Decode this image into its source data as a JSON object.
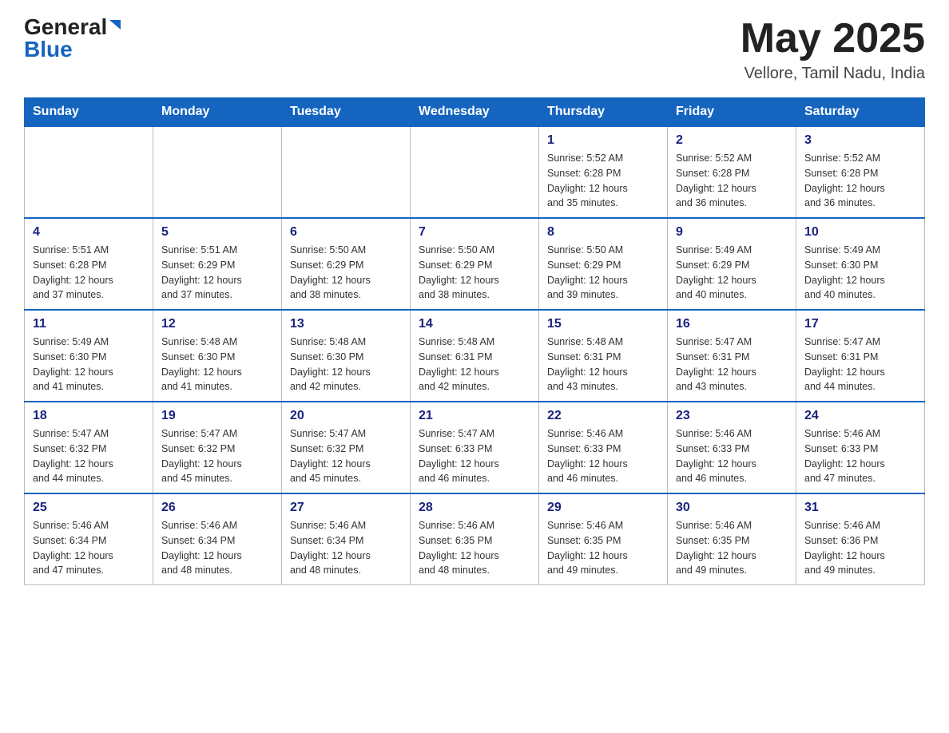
{
  "header": {
    "logo_general": "General",
    "logo_blue": "Blue",
    "month": "May 2025",
    "location": "Vellore, Tamil Nadu, India"
  },
  "days_of_week": [
    "Sunday",
    "Monday",
    "Tuesday",
    "Wednesday",
    "Thursday",
    "Friday",
    "Saturday"
  ],
  "weeks": [
    [
      {
        "day": "",
        "info": ""
      },
      {
        "day": "",
        "info": ""
      },
      {
        "day": "",
        "info": ""
      },
      {
        "day": "",
        "info": ""
      },
      {
        "day": "1",
        "info": "Sunrise: 5:52 AM\nSunset: 6:28 PM\nDaylight: 12 hours\nand 35 minutes."
      },
      {
        "day": "2",
        "info": "Sunrise: 5:52 AM\nSunset: 6:28 PM\nDaylight: 12 hours\nand 36 minutes."
      },
      {
        "day": "3",
        "info": "Sunrise: 5:52 AM\nSunset: 6:28 PM\nDaylight: 12 hours\nand 36 minutes."
      }
    ],
    [
      {
        "day": "4",
        "info": "Sunrise: 5:51 AM\nSunset: 6:28 PM\nDaylight: 12 hours\nand 37 minutes."
      },
      {
        "day": "5",
        "info": "Sunrise: 5:51 AM\nSunset: 6:29 PM\nDaylight: 12 hours\nand 37 minutes."
      },
      {
        "day": "6",
        "info": "Sunrise: 5:50 AM\nSunset: 6:29 PM\nDaylight: 12 hours\nand 38 minutes."
      },
      {
        "day": "7",
        "info": "Sunrise: 5:50 AM\nSunset: 6:29 PM\nDaylight: 12 hours\nand 38 minutes."
      },
      {
        "day": "8",
        "info": "Sunrise: 5:50 AM\nSunset: 6:29 PM\nDaylight: 12 hours\nand 39 minutes."
      },
      {
        "day": "9",
        "info": "Sunrise: 5:49 AM\nSunset: 6:29 PM\nDaylight: 12 hours\nand 40 minutes."
      },
      {
        "day": "10",
        "info": "Sunrise: 5:49 AM\nSunset: 6:30 PM\nDaylight: 12 hours\nand 40 minutes."
      }
    ],
    [
      {
        "day": "11",
        "info": "Sunrise: 5:49 AM\nSunset: 6:30 PM\nDaylight: 12 hours\nand 41 minutes."
      },
      {
        "day": "12",
        "info": "Sunrise: 5:48 AM\nSunset: 6:30 PM\nDaylight: 12 hours\nand 41 minutes."
      },
      {
        "day": "13",
        "info": "Sunrise: 5:48 AM\nSunset: 6:30 PM\nDaylight: 12 hours\nand 42 minutes."
      },
      {
        "day": "14",
        "info": "Sunrise: 5:48 AM\nSunset: 6:31 PM\nDaylight: 12 hours\nand 42 minutes."
      },
      {
        "day": "15",
        "info": "Sunrise: 5:48 AM\nSunset: 6:31 PM\nDaylight: 12 hours\nand 43 minutes."
      },
      {
        "day": "16",
        "info": "Sunrise: 5:47 AM\nSunset: 6:31 PM\nDaylight: 12 hours\nand 43 minutes."
      },
      {
        "day": "17",
        "info": "Sunrise: 5:47 AM\nSunset: 6:31 PM\nDaylight: 12 hours\nand 44 minutes."
      }
    ],
    [
      {
        "day": "18",
        "info": "Sunrise: 5:47 AM\nSunset: 6:32 PM\nDaylight: 12 hours\nand 44 minutes."
      },
      {
        "day": "19",
        "info": "Sunrise: 5:47 AM\nSunset: 6:32 PM\nDaylight: 12 hours\nand 45 minutes."
      },
      {
        "day": "20",
        "info": "Sunrise: 5:47 AM\nSunset: 6:32 PM\nDaylight: 12 hours\nand 45 minutes."
      },
      {
        "day": "21",
        "info": "Sunrise: 5:47 AM\nSunset: 6:33 PM\nDaylight: 12 hours\nand 46 minutes."
      },
      {
        "day": "22",
        "info": "Sunrise: 5:46 AM\nSunset: 6:33 PM\nDaylight: 12 hours\nand 46 minutes."
      },
      {
        "day": "23",
        "info": "Sunrise: 5:46 AM\nSunset: 6:33 PM\nDaylight: 12 hours\nand 46 minutes."
      },
      {
        "day": "24",
        "info": "Sunrise: 5:46 AM\nSunset: 6:33 PM\nDaylight: 12 hours\nand 47 minutes."
      }
    ],
    [
      {
        "day": "25",
        "info": "Sunrise: 5:46 AM\nSunset: 6:34 PM\nDaylight: 12 hours\nand 47 minutes."
      },
      {
        "day": "26",
        "info": "Sunrise: 5:46 AM\nSunset: 6:34 PM\nDaylight: 12 hours\nand 48 minutes."
      },
      {
        "day": "27",
        "info": "Sunrise: 5:46 AM\nSunset: 6:34 PM\nDaylight: 12 hours\nand 48 minutes."
      },
      {
        "day": "28",
        "info": "Sunrise: 5:46 AM\nSunset: 6:35 PM\nDaylight: 12 hours\nand 48 minutes."
      },
      {
        "day": "29",
        "info": "Sunrise: 5:46 AM\nSunset: 6:35 PM\nDaylight: 12 hours\nand 49 minutes."
      },
      {
        "day": "30",
        "info": "Sunrise: 5:46 AM\nSunset: 6:35 PM\nDaylight: 12 hours\nand 49 minutes."
      },
      {
        "day": "31",
        "info": "Sunrise: 5:46 AM\nSunset: 6:36 PM\nDaylight: 12 hours\nand 49 minutes."
      }
    ]
  ]
}
